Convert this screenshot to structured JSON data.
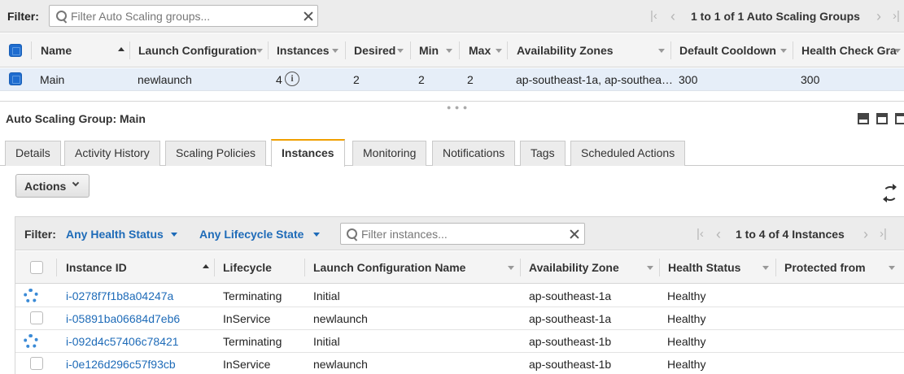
{
  "top_filter": {
    "label": "Filter:",
    "placeholder": "Filter Auto Scaling groups...",
    "pager_text": "1 to 1 of 1 Auto Scaling Groups"
  },
  "groups_table": {
    "columns": [
      "Name",
      "Launch Configuration",
      "Instances",
      "Desired",
      "Min",
      "Max",
      "Availability Zones",
      "Default Cooldown",
      "Health Check Gra"
    ],
    "rows": [
      {
        "name": "Main",
        "launch_configuration": "newlaunch",
        "instances": "4",
        "desired": "2",
        "min": "2",
        "max": "2",
        "availability_zones": "ap-southeast-1a, ap-southea…",
        "default_cooldown": "300",
        "health_check_grace": "300",
        "selected": true
      }
    ]
  },
  "detail": {
    "title": "Auto Scaling Group: Main",
    "tabs": [
      "Details",
      "Activity History",
      "Scaling Policies",
      "Instances",
      "Monitoring",
      "Notifications",
      "Tags",
      "Scheduled Actions"
    ],
    "active_tab": "Instances",
    "actions_label": "Actions"
  },
  "instances_filter": {
    "label": "Filter:",
    "health_dropdown": "Any Health Status",
    "lifecycle_dropdown": "Any Lifecycle State",
    "placeholder": "Filter instances...",
    "pager_text": "1 to 4 of 4 Instances"
  },
  "instances_table": {
    "columns": [
      "Instance ID",
      "Lifecycle",
      "Launch Configuration Name",
      "Availability Zone",
      "Health Status",
      "Protected from"
    ],
    "rows": [
      {
        "id": "i-0278f7f1b8a04247a",
        "lifecycle": "Terminating",
        "launch_config": "Initial",
        "zone": "ap-southeast-1a",
        "health": "Healthy",
        "status_icon": "spinner-icon"
      },
      {
        "id": "i-05891ba06684d7eb6",
        "lifecycle": "InService",
        "launch_config": "newlaunch",
        "zone": "ap-southeast-1a",
        "health": "Healthy",
        "status_icon": "checkbox"
      },
      {
        "id": "i-092d4c57406c78421",
        "lifecycle": "Terminating",
        "launch_config": "Initial",
        "zone": "ap-southeast-1b",
        "health": "Healthy",
        "status_icon": "spinner-icon"
      },
      {
        "id": "i-0e126d296c57f93cb",
        "lifecycle": "InService",
        "launch_config": "newlaunch",
        "zone": "ap-southeast-1b",
        "health": "Healthy",
        "status_icon": "checkbox"
      }
    ]
  },
  "colors": {
    "link": "#1e6bb8",
    "selected_row": "#e6eef8",
    "active_tab_accent": "#f0a000",
    "checkbox_selected": "#1e6ccf"
  }
}
